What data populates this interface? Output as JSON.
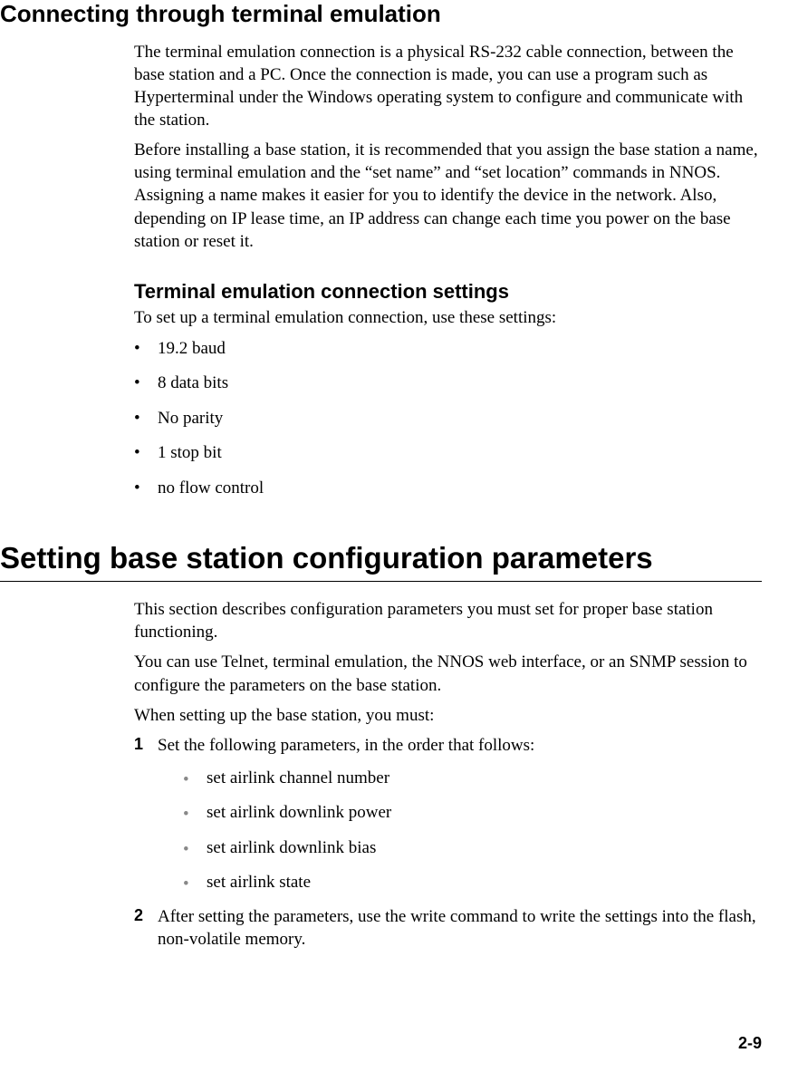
{
  "section1": {
    "heading": "Connecting through terminal emulation",
    "p1": "The terminal emulation connection is a physical RS-232 cable connection, between the base station and a PC. Once the connection is made, you can use a program such as Hyperterminal under the Windows operating system to configure and communicate with the station.",
    "p2": "Before installing a base station, it is recommended that you assign the base station a name, using terminal emulation and the “set name” and “set location” commands in NNOS. Assigning a name makes it easier for you to identify the device in the network. Also, depending on IP lease time, an IP address can change each time you power on the base station or reset it.",
    "sub": {
      "heading": "Terminal emulation connection settings",
      "intro": "To set up a terminal emulation connection, use these settings:",
      "items": {
        "0": "19.2 baud",
        "1": "8 data bits",
        "2": "No parity",
        "3": "1 stop bit",
        "4": "no flow control"
      }
    }
  },
  "section2": {
    "heading": "Setting base station configuration parameters",
    "p1": "This section describes configuration parameters you must set for proper base station functioning.",
    "p2": "You can use Telnet, terminal emulation, the NNOS web interface, or an SNMP session to configure the parameters on the base station.",
    "p3": "When setting up the base station, you must:",
    "steps": {
      "0": {
        "num": "1",
        "text": "Set the following parameters, in the order that follows:",
        "sub": {
          "0": "set airlink channel number",
          "1": "set airlink downlink power",
          "2": "set airlink downlink bias",
          "3": "set airlink state"
        }
      },
      "1": {
        "num": "2",
        "text": "After setting the parameters, use the write command to write the settings into the flash, non-volatile memory."
      }
    }
  },
  "pageNumber": "2-9"
}
